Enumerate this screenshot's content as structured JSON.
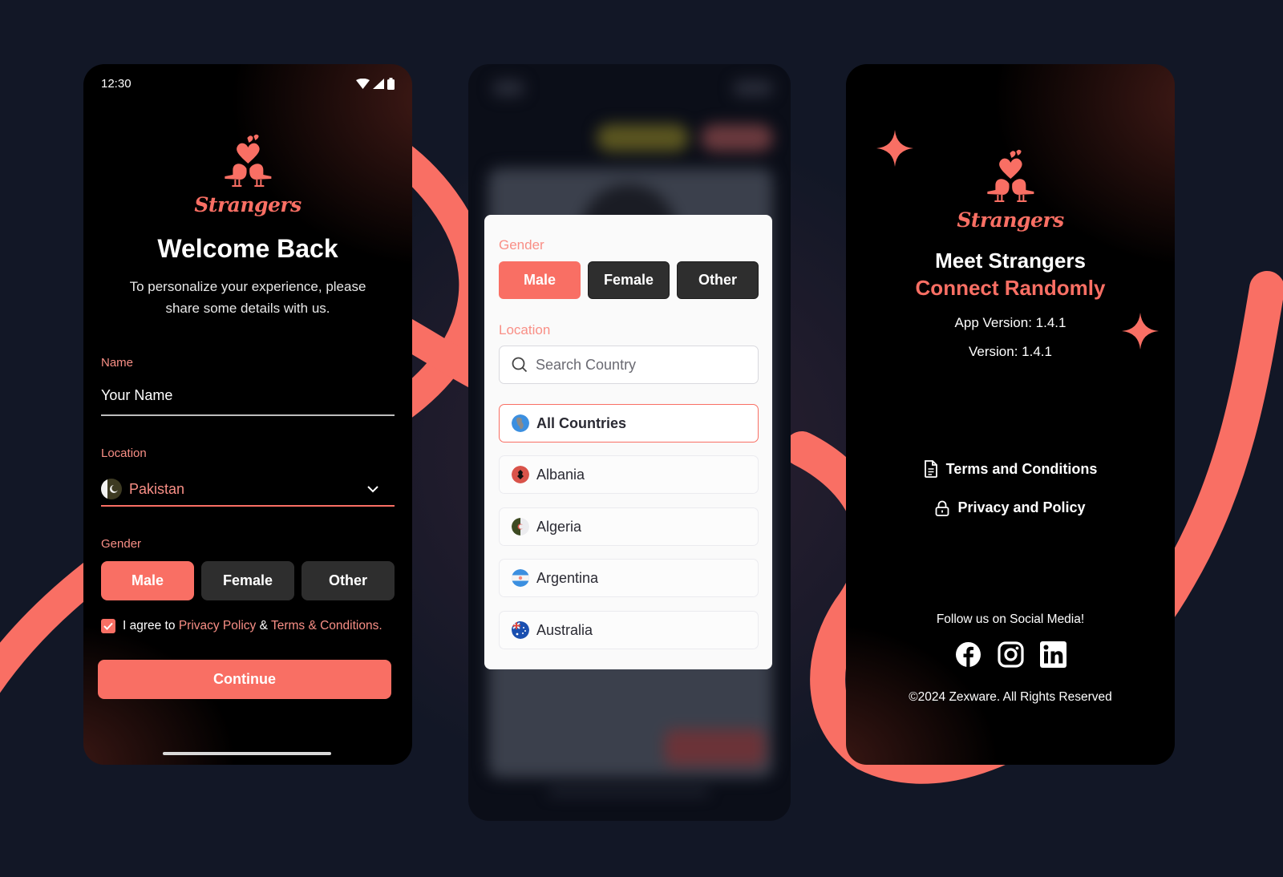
{
  "colors": {
    "accent": "#f96f64",
    "accent_light": "#f98f86",
    "page_bg": "#121726",
    "inactive_button": "#2e2e2e"
  },
  "login_screen": {
    "status_bar": {
      "time": "12:30",
      "icons": [
        "wifi-icon",
        "signal-icon",
        "battery-icon"
      ]
    },
    "brand": "Strangers",
    "title": "Welcome Back",
    "subtitle_line1": "To personalize your experience, please",
    "subtitle_line2": "share some details with us.",
    "name_field": {
      "label": "Name",
      "placeholder": "Your Name",
      "value": ""
    },
    "location_field": {
      "label": "Location",
      "value": "Pakistan",
      "flag": "pakistan-flag"
    },
    "gender": {
      "label": "Gender",
      "options": [
        "Male",
        "Female",
        "Other"
      ],
      "selected": "Male"
    },
    "agreement": {
      "checked": true,
      "prefix": "I agree to",
      "privacy_link": "Privacy Policy",
      "amp": "&",
      "terms_link": "Terms & Conditions."
    },
    "continue_label": "Continue"
  },
  "filter_screen": {
    "gender": {
      "label": "Gender",
      "options": [
        "Male",
        "Female",
        "Other"
      ],
      "selected": "Male"
    },
    "location": {
      "label": "Location",
      "search_placeholder": "Search Country",
      "countries": [
        {
          "name": "All Countries",
          "flag": "globe-icon",
          "selected": true
        },
        {
          "name": "Albania",
          "flag": "albania-flag",
          "selected": false
        },
        {
          "name": "Algeria",
          "flag": "algeria-flag",
          "selected": false
        },
        {
          "name": "Argentina",
          "flag": "argentina-flag",
          "selected": false
        },
        {
          "name": "Australia",
          "flag": "australia-flag",
          "selected": false
        }
      ]
    }
  },
  "about_screen": {
    "brand": "Strangers",
    "headline": "Meet Strangers",
    "tagline": "Connect Randomly",
    "app_version": "App Version: 1.4.1",
    "version": "Version: 1.4.1",
    "links": [
      {
        "label": "Terms and Conditions",
        "icon": "document-icon"
      },
      {
        "label": "Privacy and Policy",
        "icon": "lock-icon"
      }
    ],
    "follow_text": "Follow us on Social Media!",
    "socials": [
      "facebook-icon",
      "instagram-icon",
      "linkedin-icon"
    ],
    "copyright": "©2024 Zexware. All Rights Reserved"
  }
}
